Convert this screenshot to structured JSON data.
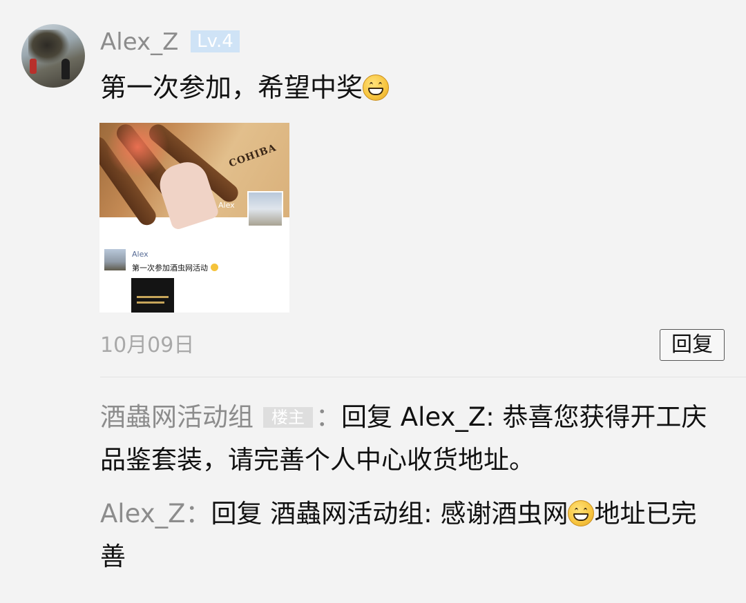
{
  "post": {
    "author": "Alex_Z",
    "level": "Lv.4",
    "text": "第一次参加，希望中奖",
    "text_emoji": "grinning-face-emoji",
    "image": {
      "photo_caption_name": "Alex",
      "brand_text": "COHIBA",
      "moments_name": "Alex",
      "moments_text": "第一次参加酒虫网活动"
    },
    "date": "10月09日",
    "reply_label": "回复"
  },
  "comments": [
    {
      "author": "酒蟲网活动组",
      "badge": "楼主",
      "separator": "：",
      "text": "回复 Alex_Z: 恭喜您获得开工庆品鉴套装，请完善个人中心收货地址。"
    },
    {
      "author": "Alex_Z",
      "separator": "：",
      "text_before_emoji": "回复 酒蟲网活动组: 感谢酒虫网",
      "emoji": "grinning-face-emoji",
      "text_after_emoji": "地址已完善"
    }
  ],
  "colors": {
    "background": "#f3f3f3",
    "name_gray": "#8c8c8c",
    "level_badge": "#cfe3f6",
    "link_blue": "#576b95"
  }
}
